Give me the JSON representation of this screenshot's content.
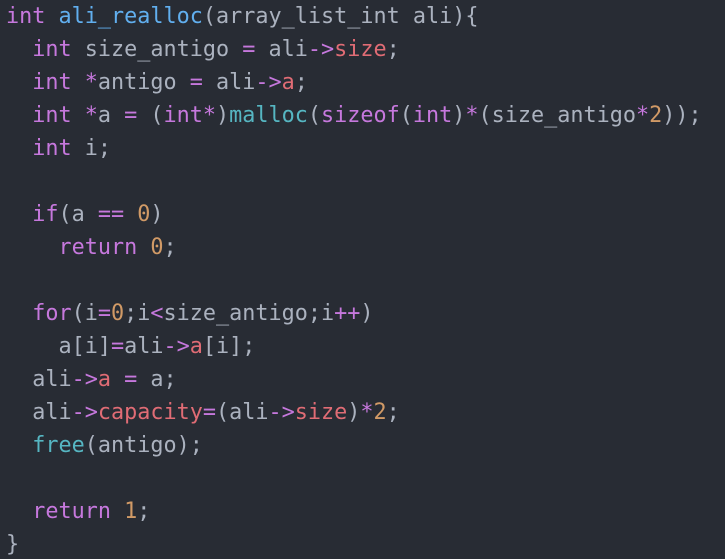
{
  "code": {
    "language": "c",
    "lines": [
      [
        [
          "int",
          "type"
        ],
        [
          " ",
          "plain"
        ],
        [
          "ali_realloc",
          "fn"
        ],
        [
          "(array_list_int ali){",
          "plain"
        ]
      ],
      [
        [
          "  ",
          "plain"
        ],
        [
          "int",
          "type"
        ],
        [
          " size_antigo ",
          "plain"
        ],
        [
          "=",
          "op"
        ],
        [
          " ali",
          "plain"
        ],
        [
          "->",
          "op"
        ],
        [
          "size",
          "prop"
        ],
        [
          ";",
          "plain"
        ]
      ],
      [
        [
          "  ",
          "plain"
        ],
        [
          "int",
          "type"
        ],
        [
          " ",
          "plain"
        ],
        [
          "*",
          "op"
        ],
        [
          "antigo ",
          "plain"
        ],
        [
          "=",
          "op"
        ],
        [
          " ali",
          "plain"
        ],
        [
          "->",
          "op"
        ],
        [
          "a",
          "prop"
        ],
        [
          ";",
          "plain"
        ]
      ],
      [
        [
          "  ",
          "plain"
        ],
        [
          "int",
          "type"
        ],
        [
          " ",
          "plain"
        ],
        [
          "*",
          "op"
        ],
        [
          "a ",
          "plain"
        ],
        [
          "=",
          "op"
        ],
        [
          " (",
          "plain"
        ],
        [
          "int",
          "type"
        ],
        [
          "*",
          "op"
        ],
        [
          ")",
          "plain"
        ],
        [
          "malloc",
          "builtin"
        ],
        [
          "(",
          "plain"
        ],
        [
          "sizeof",
          "type"
        ],
        [
          "(",
          "plain"
        ],
        [
          "int",
          "type"
        ],
        [
          ")",
          "plain"
        ],
        [
          "*",
          "op"
        ],
        [
          "(size_antigo",
          "plain"
        ],
        [
          "*",
          "op"
        ],
        [
          "2",
          "num"
        ],
        [
          "));",
          "plain"
        ]
      ],
      [
        [
          "  ",
          "plain"
        ],
        [
          "int",
          "type"
        ],
        [
          " i;",
          "plain"
        ]
      ],
      [],
      [
        [
          "  ",
          "plain"
        ],
        [
          "if",
          "ctrl"
        ],
        [
          "(a ",
          "plain"
        ],
        [
          "==",
          "op"
        ],
        [
          " ",
          "plain"
        ],
        [
          "0",
          "num"
        ],
        [
          ")",
          "plain"
        ]
      ],
      [
        [
          "    ",
          "plain"
        ],
        [
          "return",
          "ctrl"
        ],
        [
          " ",
          "plain"
        ],
        [
          "0",
          "num"
        ],
        [
          ";",
          "plain"
        ]
      ],
      [],
      [
        [
          "  ",
          "plain"
        ],
        [
          "for",
          "ctrl"
        ],
        [
          "(i",
          "plain"
        ],
        [
          "=",
          "op"
        ],
        [
          "0",
          "num"
        ],
        [
          ";i",
          "plain"
        ],
        [
          "<",
          "op"
        ],
        [
          "size_antigo;i",
          "plain"
        ],
        [
          "++",
          "op"
        ],
        [
          ")",
          "plain"
        ]
      ],
      [
        [
          "    a[i]",
          "plain"
        ],
        [
          "=",
          "op"
        ],
        [
          "ali",
          "plain"
        ],
        [
          "->",
          "op"
        ],
        [
          "a",
          "prop"
        ],
        [
          "[i];",
          "plain"
        ]
      ],
      [
        [
          "  ali",
          "plain"
        ],
        [
          "->",
          "op"
        ],
        [
          "a",
          "prop"
        ],
        [
          " ",
          "plain"
        ],
        [
          "=",
          "op"
        ],
        [
          " a;",
          "plain"
        ]
      ],
      [
        [
          "  ali",
          "plain"
        ],
        [
          "->",
          "op"
        ],
        [
          "capacity",
          "prop"
        ],
        [
          "=",
          "op"
        ],
        [
          "(ali",
          "plain"
        ],
        [
          "->",
          "op"
        ],
        [
          "size",
          "prop"
        ],
        [
          ")",
          "plain"
        ],
        [
          "*",
          "op"
        ],
        [
          "2",
          "num"
        ],
        [
          ";",
          "plain"
        ]
      ],
      [
        [
          "  ",
          "plain"
        ],
        [
          "free",
          "builtin"
        ],
        [
          "(antigo);",
          "plain"
        ]
      ],
      [],
      [
        [
          "  ",
          "plain"
        ],
        [
          "return",
          "ctrl"
        ],
        [
          " ",
          "plain"
        ],
        [
          "1",
          "num"
        ],
        [
          ";",
          "plain"
        ]
      ],
      [
        [
          "}",
          "plain"
        ]
      ]
    ]
  },
  "theme": {
    "background": "#282c34",
    "foreground": "#abb2bf",
    "type": "#c678dd",
    "ctrl": "#c678dd",
    "op": "#c678dd",
    "fn": "#61afef",
    "builtin": "#56b6c2",
    "prop": "#e06c75",
    "num": "#d19a66",
    "plain": "#abb2bf"
  }
}
